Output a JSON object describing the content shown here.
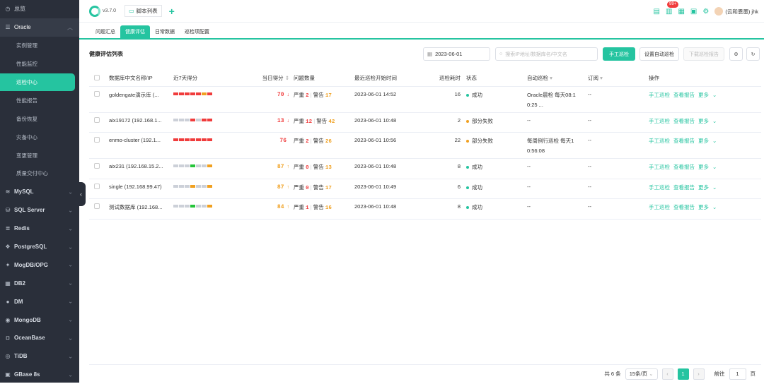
{
  "sidebar": {
    "overview": "总览",
    "oracle": "Oracle",
    "oracle_items": [
      "实例管理",
      "性能监控",
      "巡检中心",
      "性能报告",
      "备份恢复",
      "灾备中心",
      "变更管理",
      "质量交付中心"
    ],
    "active_item": "巡检中心",
    "groups": [
      "MySQL",
      "SQL Server",
      "Redis",
      "PostgreSQL",
      "MogDB/OPG",
      "DB2",
      "DM",
      "MongoDB",
      "OceanBase",
      "TiDB",
      "GBase 8s"
    ]
  },
  "topbar": {
    "version": "v3.7.0",
    "tab_label": "脚本列表",
    "badge": "99+",
    "user": "(云和恩墨) jhk"
  },
  "subtabs": [
    "问题汇总",
    "健康评估",
    "日常数据",
    "巡检项配置"
  ],
  "active_subtab": "健康评估",
  "toolbar": {
    "title": "健康评估列表",
    "date": "2023-06-01",
    "search_placeholder": "搜索IP地址/数据库名/中文名",
    "manual_btn": "手工巡检",
    "auto_btn": "设置自动巡检",
    "download_btn": "下载巡检报告"
  },
  "table": {
    "headers": {
      "name": "数据库中文名称/IP",
      "trend": "近7天得分",
      "score": "当日得分",
      "issues": "问题数量",
      "start": "最近巡检开始时间",
      "duration": "巡检耗时",
      "status": "状态",
      "auto": "自动巡检",
      "sub": "订阅",
      "ops": "操作"
    },
    "sev_label": "严重",
    "warn_label": "警告",
    "ops": {
      "manual": "手工巡检",
      "report": "查看报告",
      "more": "更多"
    },
    "rows": [
      {
        "name": "goldengate演示库 (...",
        "bars": [
          "#f03c3c",
          "#f03c3c",
          "#f03c3c",
          "#f03c3c",
          "#f03c3c",
          "#f0a020",
          "#f03c3c"
        ],
        "score": "70",
        "arrow": "↓",
        "score_color": "red",
        "sev": "2",
        "warn": "17",
        "start": "2023-06-01 14:52",
        "duration": "16",
        "status": "成功",
        "status_color": "#25c4a0",
        "auto": "Oracle晨检 每天08:1",
        "auto2": "0:25 ...",
        "sub": "--",
        "tall": true
      },
      {
        "name": "aix19172 (192.168.1...",
        "bars": [
          "#ccd0d8",
          "#ccd0d8",
          "#ccd0d8",
          "#f03c3c",
          "#ccd0d8",
          "#f03c3c",
          "#f03c3c"
        ],
        "score": "13",
        "arrow": "↓",
        "score_color": "red",
        "sev": "12",
        "warn": "42",
        "start": "2023-06-01 10:48",
        "duration": "2",
        "status": "部分失败",
        "status_color": "#f0a020",
        "auto": "--",
        "auto2": "",
        "sub": "--",
        "tall": false
      },
      {
        "name": "enmo-cluster (192.1...",
        "bars": [
          "#f03c3c",
          "#f03c3c",
          "#f03c3c",
          "#f03c3c",
          "#f03c3c",
          "#f03c3c",
          "#f03c3c"
        ],
        "score": "76",
        "arrow": "",
        "score_color": "red",
        "sev": "2",
        "warn": "26",
        "start": "2023-06-01 10:56",
        "duration": "22",
        "status": "部分失败",
        "status_color": "#f0a020",
        "auto": "每周例行巡检 每天1",
        "auto2": "0:56:08",
        "sub": "--",
        "tall": true
      },
      {
        "name": "aix231 (192.168.15.2...",
        "bars": [
          "#ccd0d8",
          "#ccd0d8",
          "#ccd0d8",
          "#25c43a",
          "#ccd0d8",
          "#ccd0d8",
          "#f0a020"
        ],
        "score": "87",
        "arrow": "↑",
        "score_color": "org",
        "sev": "0",
        "warn": "13",
        "start": "2023-06-01 10:48",
        "duration": "8",
        "status": "成功",
        "status_color": "#25c4a0",
        "auto": "--",
        "auto2": "",
        "sub": "--",
        "tall": false
      },
      {
        "name": "single (192.168.99.47)",
        "bars": [
          "#ccd0d8",
          "#ccd0d8",
          "#ccd0d8",
          "#f0a020",
          "#ccd0d8",
          "#ccd0d8",
          "#f0a020"
        ],
        "score": "87",
        "arrow": "↑",
        "score_color": "org",
        "sev": "0",
        "warn": "17",
        "start": "2023-06-01 10:49",
        "duration": "6",
        "status": "成功",
        "status_color": "#25c4a0",
        "auto": "--",
        "auto2": "",
        "sub": "--",
        "tall": false
      },
      {
        "name": "测试数据库 (192.168...",
        "bars": [
          "#ccd0d8",
          "#ccd0d8",
          "#ccd0d8",
          "#25c43a",
          "#ccd0d8",
          "#ccd0d8",
          "#f0a020"
        ],
        "score": "84",
        "arrow": "↑",
        "score_color": "org",
        "sev": "1",
        "warn": "16",
        "start": "2023-06-01 10:48",
        "duration": "8",
        "status": "成功",
        "status_color": "#25c4a0",
        "auto": "--",
        "auto2": "",
        "sub": "--",
        "tall": false
      }
    ]
  },
  "pager": {
    "total": "共 6 条",
    "size": "15条/页",
    "current": "1",
    "goto": "前往",
    "goto_val": "1",
    "page_unit": "页"
  }
}
